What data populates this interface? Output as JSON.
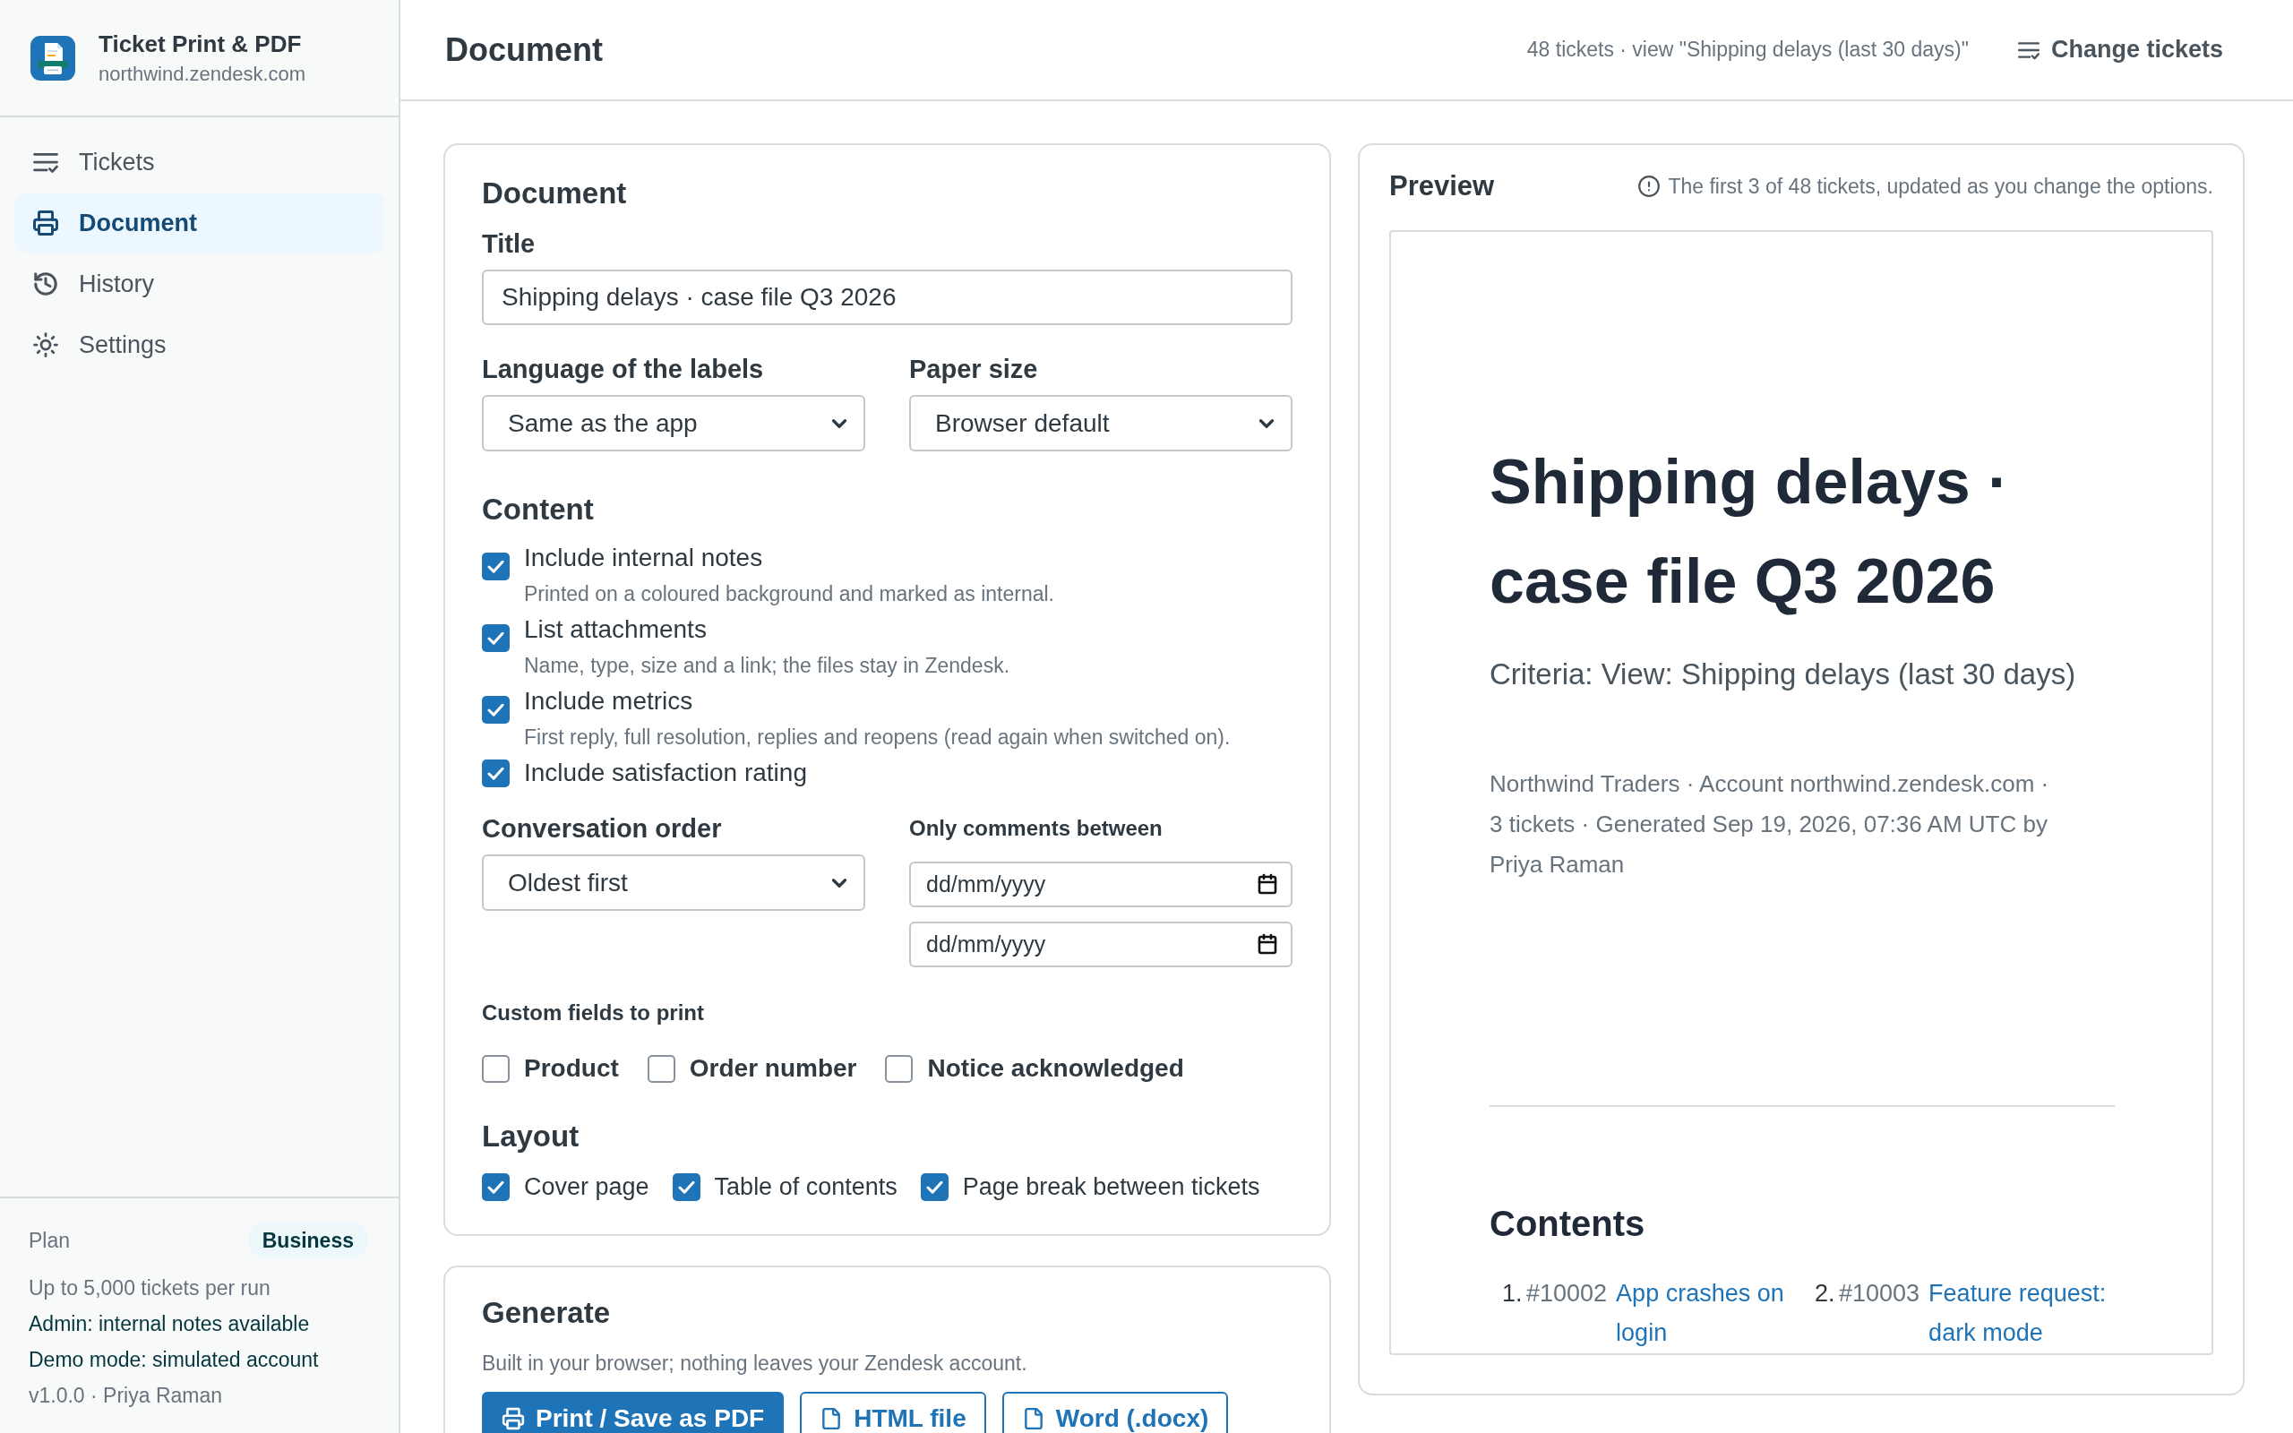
{
  "app": {
    "name": "Ticket Print & PDF",
    "domain": "northwind.zendesk.com"
  },
  "nav": [
    {
      "label": "Tickets",
      "selected": false
    },
    {
      "label": "Document",
      "selected": true
    },
    {
      "label": "History",
      "selected": false
    },
    {
      "label": "Settings",
      "selected": false
    }
  ],
  "plan": {
    "label": "Plan",
    "badge": "Business",
    "lines": [
      {
        "text": "Up to 5,000 tickets per run",
        "kind": "muted"
      },
      {
        "text": "Admin: internal notes available",
        "kind": "status"
      },
      {
        "text": "Demo mode: simulated account",
        "kind": "status"
      },
      {
        "text": "v1.0.0 · Priya Raman",
        "kind": "muted"
      }
    ]
  },
  "header": {
    "title": "Document",
    "summary": "48 tickets · view \"Shipping delays (last 30 days)\"",
    "action": "Change tickets"
  },
  "document": {
    "heading": "Document",
    "title": {
      "label": "Title",
      "value": "Shipping delays · case file Q3 2026"
    },
    "language": {
      "label": "Language of the labels",
      "value": "Same as the app"
    },
    "paper_size": {
      "label": "Paper size",
      "value": "Browser default"
    }
  },
  "content": {
    "heading": "Content",
    "options": [
      {
        "label": "Include internal notes",
        "description": "Printed on a coloured background and marked as internal.",
        "checked": true
      },
      {
        "label": "List attachments",
        "description": "Name, type, size and a link; the files stay in Zendesk.",
        "checked": true
      },
      {
        "label": "Include metrics",
        "description": "First reply, full resolution, replies and reopens (read again when switched on).",
        "checked": true
      },
      {
        "label": "Include satisfaction rating",
        "checked": true
      }
    ]
  },
  "conversation_order": {
    "label": "Conversation order",
    "value": "Oldest first"
  },
  "comments_between": {
    "label": "Only comments between",
    "from": {
      "placeholder": "dd/mm/yyyy"
    },
    "to": {
      "placeholder": "dd/mm/yyyy"
    }
  },
  "custom_fields": {
    "label": "Custom fields to print",
    "fields": [
      {
        "label": "Product",
        "checked": false
      },
      {
        "label": "Order number",
        "checked": false
      },
      {
        "label": "Notice acknowledged",
        "checked": false
      }
    ]
  },
  "layout": {
    "heading": "Layout",
    "options": [
      {
        "label": "Cover page",
        "checked": true
      },
      {
        "label": "Table of contents",
        "checked": true
      },
      {
        "label": "Page break between tickets",
        "checked": true
      }
    ]
  },
  "generate": {
    "heading": "Generate",
    "description": "Built in your browser; nothing leaves your Zendesk account.",
    "buttons": [
      {
        "label": "Print / Save as PDF",
        "kind": "primary"
      },
      {
        "label": "HTML file",
        "kind": "secondary"
      },
      {
        "label": "Word (.docx)",
        "kind": "secondary"
      }
    ]
  },
  "preview": {
    "heading": "Preview",
    "note": "The first 3 of 48 tickets, updated as you change the options.",
    "cover": {
      "title": "Shipping delays · case file Q3 2026",
      "criteria": "Criteria: View: Shipping delays (last 30 days)",
      "meta": "Northwind Traders · Account northwind.zendesk.com · 3 tickets · Generated Sep 19, 2026, 07:36 AM UTC by Priya Raman"
    },
    "contents": {
      "heading": "Contents",
      "items": [
        {
          "number": "1.",
          "ticket": "#10002",
          "subject": "App crashes on login"
        },
        {
          "number": "2.",
          "ticket": "#10003",
          "subject": "Feature request: dark mode"
        }
      ]
    }
  }
}
